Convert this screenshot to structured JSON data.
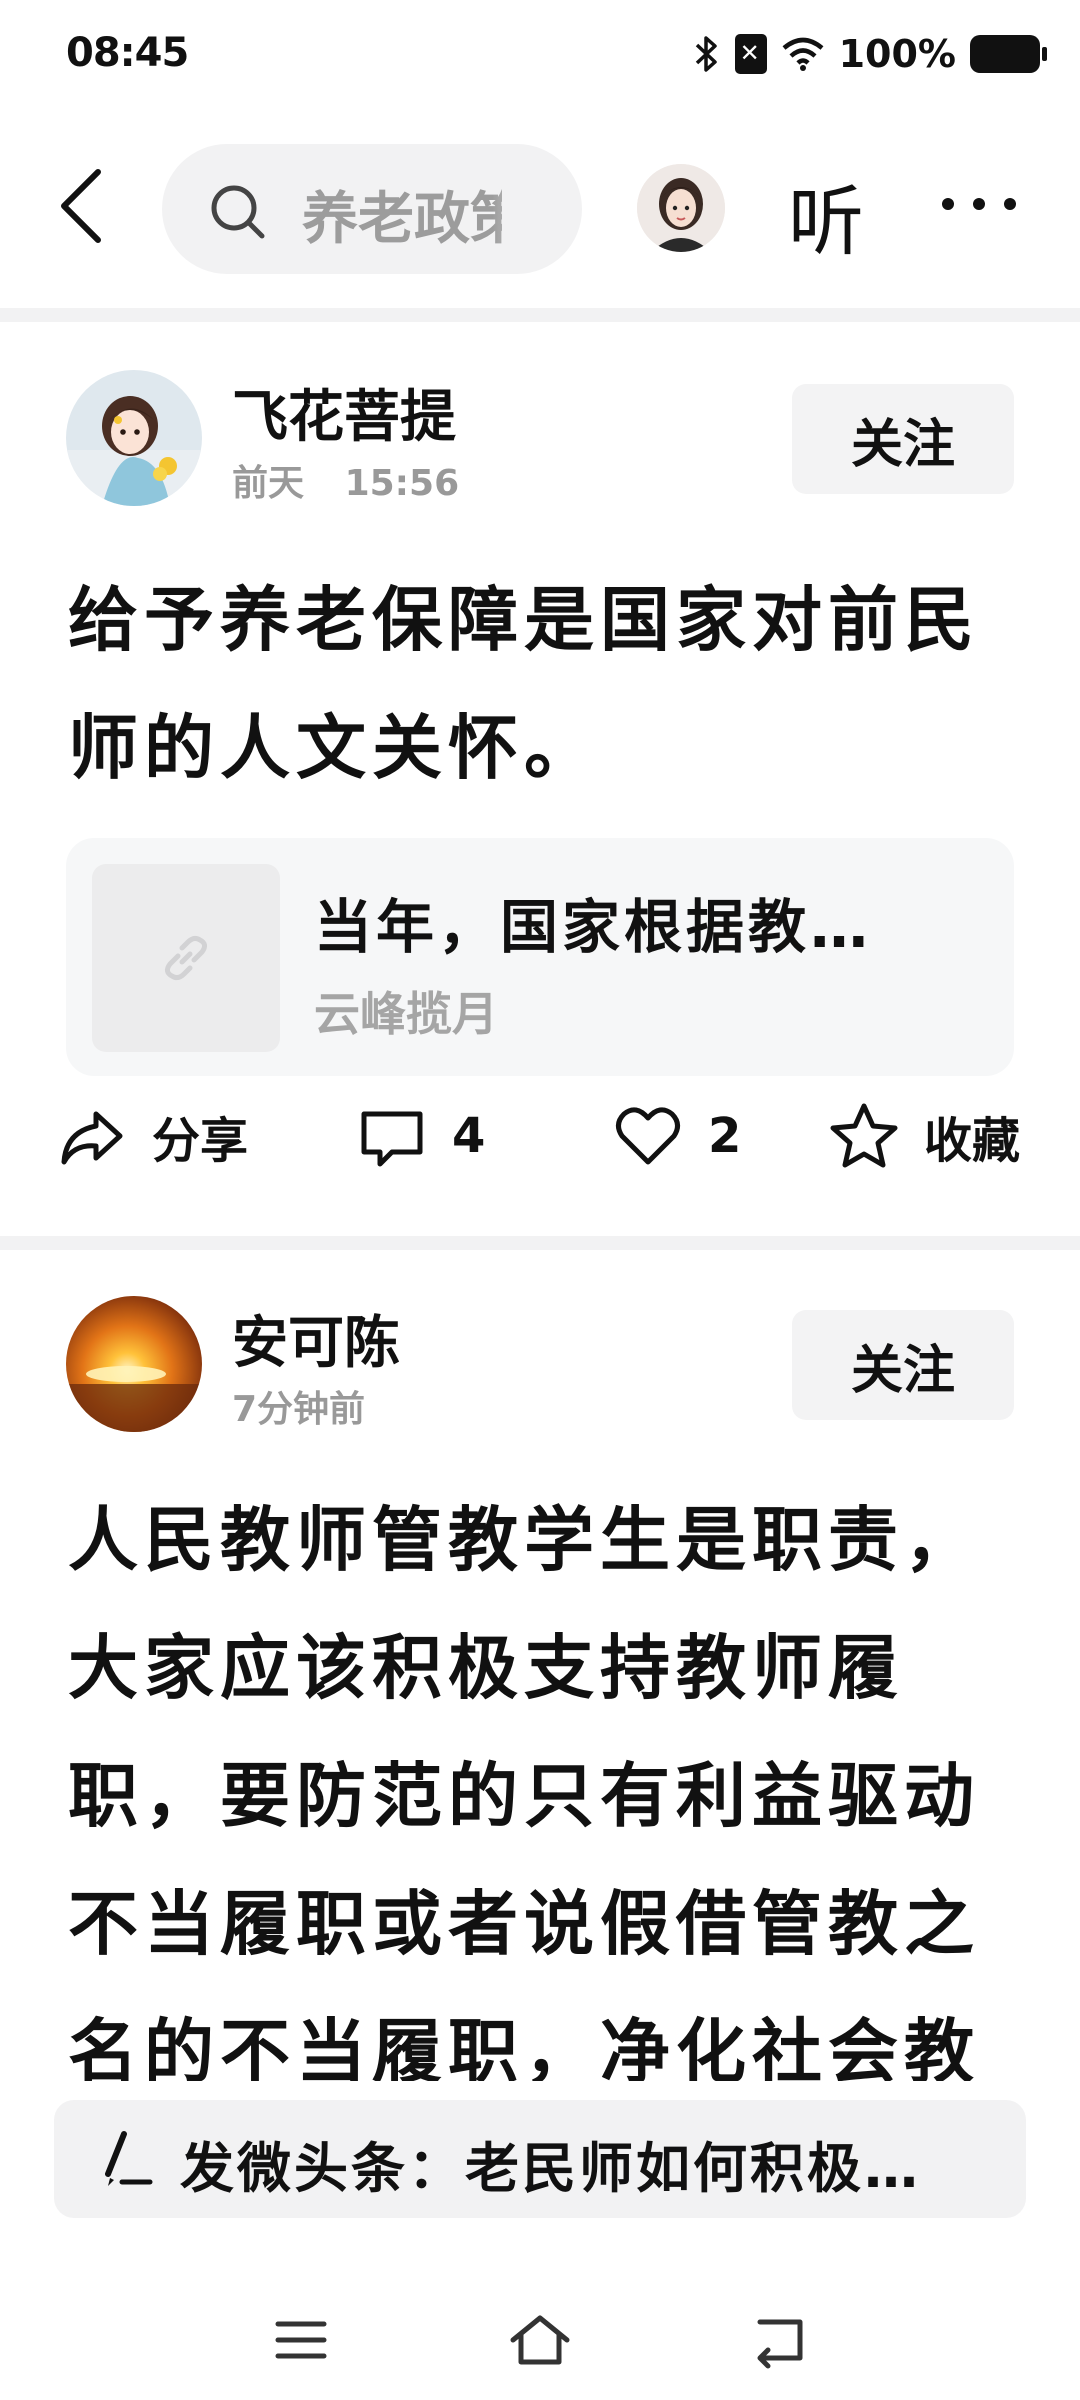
{
  "status_bar": {
    "time": "08:45",
    "battery": "100%"
  },
  "topnav": {
    "search_text": "养老政策",
    "listen_label": "听"
  },
  "posts": [
    {
      "author": "飞花菩提",
      "time_day": "前天",
      "time_clock": "15:56",
      "follow_label": "关注",
      "body_lines": [
        "给予养老保障是国家对前民",
        "师的人文关怀。"
      ],
      "link_card": {
        "title": "当年，国家根据教…",
        "source": "云峰揽月"
      },
      "actions": {
        "share_label": "分享",
        "comment_count": "4",
        "like_count": "2",
        "favorite_label": "收藏"
      }
    },
    {
      "author": "安可陈",
      "time": "7分钟前",
      "follow_label": "关注",
      "body_lines": [
        "人民教师管教学生是职责，",
        "大家应该积极支持教师履",
        "职，要防范的只有利益驱动",
        "不当履职或者说假借管教之",
        "名的不当履职，净化社会教"
      ]
    }
  ],
  "compose": {
    "text": "发微头条：老民师如何积极…"
  },
  "icons": [
    "back-icon",
    "search-icon",
    "more-icon",
    "share-icon",
    "comment-icon",
    "heart-icon",
    "star-icon",
    "link-icon",
    "pen-icon",
    "menu-icon",
    "home-icon",
    "return-icon"
  ]
}
